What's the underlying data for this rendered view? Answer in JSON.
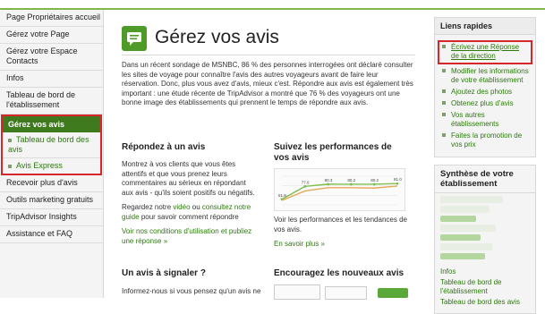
{
  "left_nav": {
    "items_top": [
      {
        "label": "Page Propriétaires accueil",
        "name": "nav-item-owners-home"
      },
      {
        "label": "Gérez votre Page",
        "name": "nav-item-manage-page"
      },
      {
        "label": "Gérez votre Espace Contacts",
        "name": "nav-item-contacts"
      },
      {
        "label": "Infos",
        "name": "nav-item-infos"
      },
      {
        "label": "Tableau de bord de l'établissement",
        "name": "nav-item-dashboard"
      }
    ],
    "active": "Gérez vos avis",
    "sub_items": [
      "Tableau de bord des avis",
      "Avis Express"
    ],
    "items_bottom": [
      {
        "label": "Recevoir plus d'avis",
        "name": "nav-item-more-reviews"
      },
      {
        "label": "Outils marketing gratuits",
        "name": "nav-item-marketing-tools"
      },
      {
        "label": "TripAdvisor Insights",
        "name": "nav-item-insights"
      },
      {
        "label": "Assistance et FAQ",
        "name": "nav-item-faq"
      }
    ]
  },
  "main": {
    "title": "Gérez vos avis",
    "intro": "Dans un récent sondage de MSNBC, 86 % des personnes interrogées ont déclaré consulter les sites de voyage pour connaître l'avis des autres voyageurs avant de faire leur réservation. Donc, plus vous avez d'avis, mieux c'est. Répondre aux avis est également très important : une étude récente de TripAdvisor a montré que 76 % des voyageurs ont une bonne image des établissements qui prennent le temps de répondre aux avis.",
    "respond": {
      "heading": "Répondez à un avis",
      "body": "Montrez à vos clients que vous êtes attentifs et que vous prenez leurs commentaires au sérieux en répondant aux avis - qu'ils soient positifs ou négatifs.",
      "watch_prefix": "Regardez notre",
      "video": "vidéo",
      "or": "ou",
      "guide": "consultez notre guide",
      "watch_suffix": "pour savoir comment répondre",
      "conditions": "Voir nos conditions d'utilisation et publiez une réponse »"
    },
    "follow": {
      "heading": "Suivez les performances de vos avis",
      "body": "Voir les performances et les tendances de vos avis.",
      "more": "En savoir plus »"
    },
    "report": {
      "heading": "Un avis à signaler ?",
      "body": "Informez-nous si vous pensez qu'un avis ne"
    },
    "encourage": {
      "heading": "Encouragez les nouveaux avis"
    }
  },
  "chart_data": {
    "type": "line",
    "series": [
      {
        "values": [
          61.8,
          77.6,
          80.3,
          80.2,
          80.2,
          81.0
        ]
      },
      {
        "values": [
          60.5,
          72.0,
          76.0,
          76.0,
          75.5,
          78.0
        ]
      }
    ],
    "value_labels": [
      "61.8",
      "77.6",
      "80.3",
      "80.2",
      "80.2",
      "81.0"
    ],
    "colors": [
      "#7fbf4f",
      "#e7a85a"
    ]
  },
  "right": {
    "quick_links_title": "Liens rapides",
    "quick_links": [
      "Écrivez une Réponse de la direction",
      "Modifier les informations de votre établissement",
      "Ajoutez des photos",
      "Obtenez plus d'avis",
      "Vos autres établissements",
      "Faites la promotion de vos prix"
    ],
    "synthesis_title": "Synthèse de votre établissement",
    "synthesis_links": [
      "Infos",
      "Tableau de bord de l'établissement",
      "Tableau de bord des avis"
    ]
  },
  "colors": {
    "accent_green": "#3f7a1f",
    "link_green": "#2b7a0b",
    "highlight_red": "#d6262a"
  }
}
